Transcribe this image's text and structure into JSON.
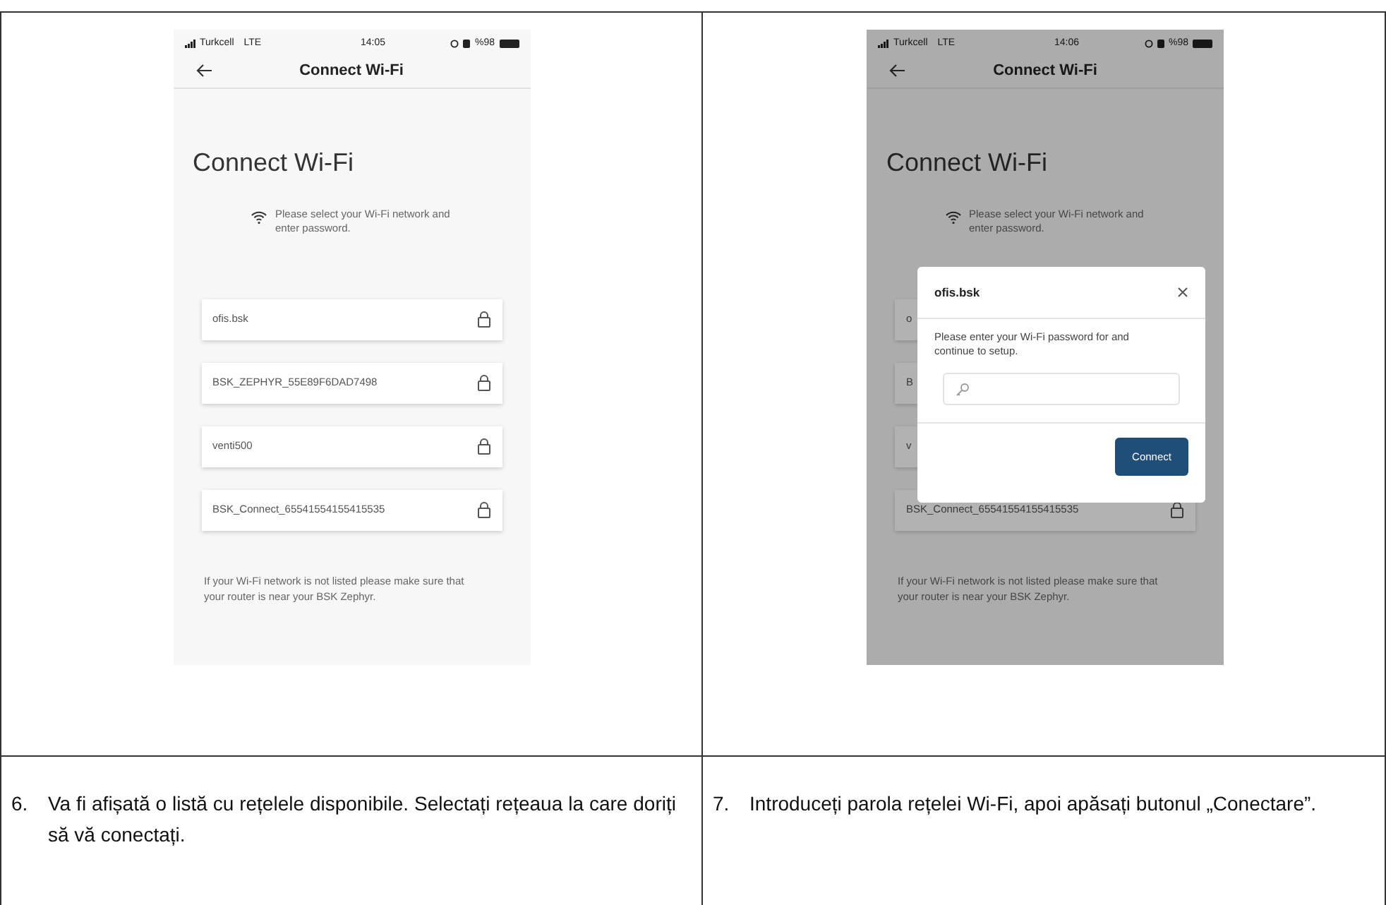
{
  "steps": [
    {
      "screen": {
        "status_bar": {
          "carrier": "Turkcell",
          "network": "LTE",
          "time": "14:05",
          "battery": "%98"
        },
        "header": {
          "title": "Connect Wi-Fi"
        },
        "heading": "Connect Wi-Fi",
        "hint": "Please select your Wi-Fi network and enter password.",
        "networks": [
          {
            "name": "ofis.bsk"
          },
          {
            "name": "BSK_ZEPHYR_55E89F6DAD7498"
          },
          {
            "name": "venti500"
          },
          {
            "name": "BSK_Connect_65541554155415535"
          }
        ],
        "footer": "If your Wi-Fi network is not listed please make sure that your router is near your BSK Zephyr."
      },
      "number": "6.",
      "text": "Va fi afișată o listă cu rețelele disponibile. Selectați rețeaua la care doriți să vă conectați."
    },
    {
      "screen": {
        "status_bar": {
          "carrier": "Turkcell",
          "network": "LTE",
          "time": "14:06",
          "battery": "%98"
        },
        "header": {
          "title": "Connect Wi-Fi"
        },
        "heading": "Connect Wi-Fi",
        "hint": "Please select your Wi-Fi network and enter password.",
        "networks": [
          {
            "name": "o"
          },
          {
            "name": "B"
          },
          {
            "name": "v"
          },
          {
            "name": "BSK_Connect_65541554155415535"
          }
        ],
        "footer": "If your Wi-Fi network is not listed please make sure that your router is near your BSK Zephyr.",
        "dialog": {
          "title": "ofis.bsk",
          "message": "Please enter your Wi-Fi password for and continue to setup.",
          "button": "Connect"
        }
      },
      "number": "7.",
      "text": "Introduceți parola rețelei Wi-Fi, apoi apăsați butonul „Conectare”."
    }
  ]
}
